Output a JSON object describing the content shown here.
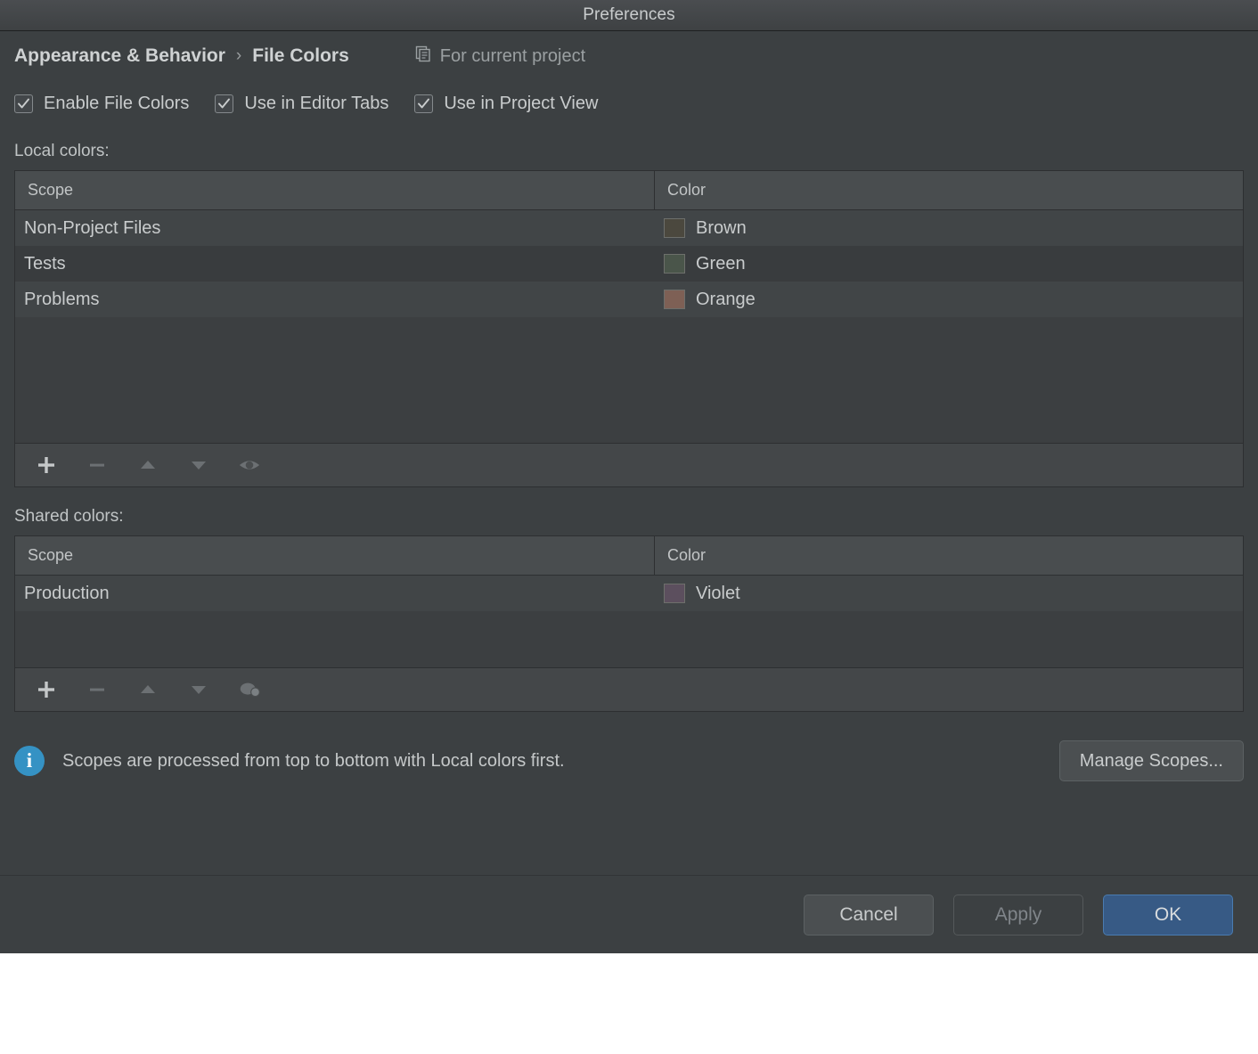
{
  "window": {
    "title": "Preferences"
  },
  "breadcrumb": {
    "category": "Appearance & Behavior",
    "separator": "›",
    "page": "File Colors",
    "scope_note": "For current project",
    "scope_note_icon": "module-copy-icon"
  },
  "checkboxes": [
    {
      "label": "Enable File Colors",
      "checked": true
    },
    {
      "label": "Use in Editor Tabs",
      "checked": true
    },
    {
      "label": "Use in Project View",
      "checked": true
    }
  ],
  "local": {
    "label": "Local colors:",
    "columns": [
      "Scope",
      "Color"
    ],
    "rows": [
      {
        "scope": "Non-Project Files",
        "color_name": "Brown",
        "swatch": "#4b483e"
      },
      {
        "scope": "Tests",
        "color_name": "Green",
        "swatch": "#4a554a"
      },
      {
        "scope": "Problems",
        "color_name": "Orange",
        "swatch": "#7e6055"
      }
    ],
    "toolbar": [
      {
        "name": "add-button",
        "glyph": "plus",
        "enabled": true
      },
      {
        "name": "remove-button",
        "glyph": "minus",
        "enabled": false
      },
      {
        "name": "move-up-button",
        "glyph": "up",
        "enabled": false
      },
      {
        "name": "move-down-button",
        "glyph": "down",
        "enabled": false
      },
      {
        "name": "share-scope-button",
        "glyph": "eye",
        "enabled": false
      }
    ]
  },
  "shared": {
    "label": "Shared colors:",
    "columns": [
      "Scope",
      "Color"
    ],
    "rows": [
      {
        "scope": "Production",
        "color_name": "Violet",
        "swatch": "#5c4f5e"
      }
    ],
    "toolbar": [
      {
        "name": "add-button",
        "glyph": "plus",
        "enabled": true
      },
      {
        "name": "remove-button",
        "glyph": "minus",
        "enabled": false
      },
      {
        "name": "move-up-button",
        "glyph": "up",
        "enabled": false
      },
      {
        "name": "move-down-button",
        "glyph": "down",
        "enabled": false
      },
      {
        "name": "unshare-scope-button",
        "glyph": "blobs",
        "enabled": false
      }
    ]
  },
  "info": {
    "icon": "info-icon",
    "icon_glyph": "i",
    "text": "Scopes are processed from top to bottom with Local colors first.",
    "manage_label": "Manage Scopes..."
  },
  "footer": {
    "cancel": "Cancel",
    "apply": "Apply",
    "ok": "OK"
  },
  "colors": {
    "accent_ok": "#375a85",
    "info_blue": "#3592c4",
    "dialog_bg": "#3c4042",
    "table_bg": "#3c3f41",
    "row_even": "#414547",
    "row_odd": "#393c3e",
    "header_bg": "#494d4f"
  }
}
